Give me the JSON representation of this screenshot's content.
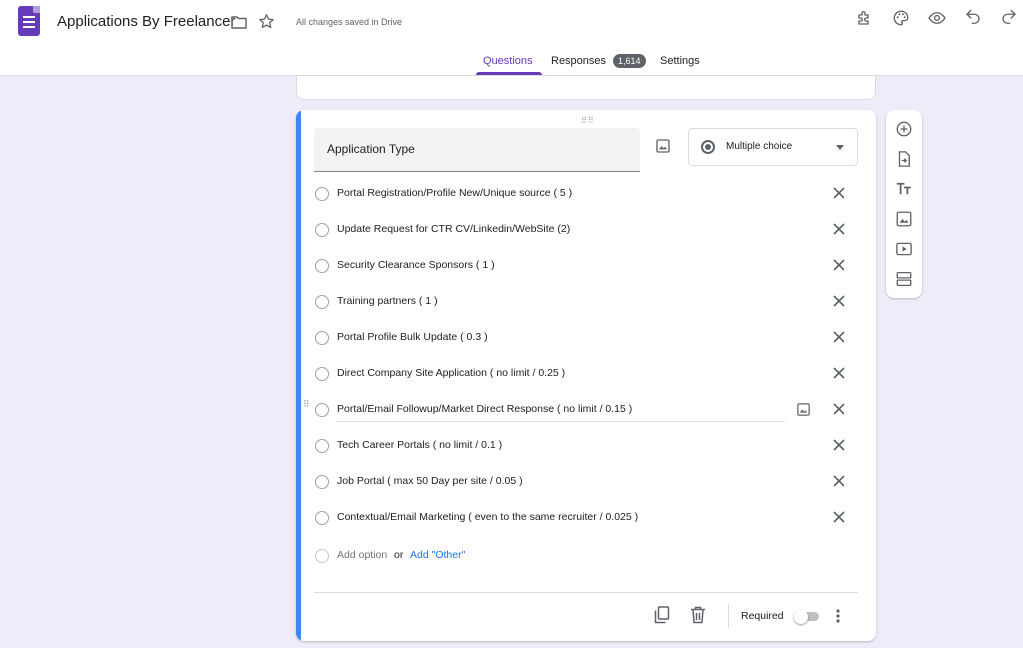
{
  "header": {
    "title": "Applications By Freelancer",
    "saved_status": "All changes saved in Drive",
    "icons": [
      "forms-logo",
      "folder-icon",
      "star-icon",
      "addon-puzzle-icon",
      "palette-icon",
      "preview-eye-icon",
      "undo-icon",
      "redo-icon"
    ]
  },
  "tabs": [
    {
      "label": "Questions",
      "active": true
    },
    {
      "label": "Responses",
      "badge": "1,614"
    },
    {
      "label": "Settings"
    }
  ],
  "question": {
    "title": "Application Type",
    "type": "Multiple choice",
    "options": [
      "Portal Registration/Profile New/Unique source ( 5 )",
      "Update Request for CTR CV/Linkedin/WebSite (2)",
      "Security Clearance Sponsors ( 1 )",
      "Training partners ( 1 )",
      "Portal Profile Bulk Update ( 0.3 )",
      "Direct Company Site Application ( no limit / 0.25 )",
      "Portal/Email Followup/Market Direct Response ( no limit / 0.15 )",
      "Tech Career Portals ( no limit / 0.1 )",
      "Job Portal ( max 50  Day per site / 0.05 )",
      "Contextual/Email Marketing ( even to the same recruiter  / 0.025 )"
    ],
    "add_option": "Add option",
    "or": "or",
    "add_other": "Add \"Other\"",
    "required_label": "Required",
    "required": false
  },
  "colors": {
    "accent": "#673ab7",
    "focus_bar": "#4285f4",
    "link": "#1a73e8",
    "background": "#f0ebf8"
  },
  "toolbar": [
    "add-question-icon",
    "import-questions-icon",
    "add-title-icon",
    "add-image-icon",
    "add-video-icon",
    "add-section-icon"
  ]
}
